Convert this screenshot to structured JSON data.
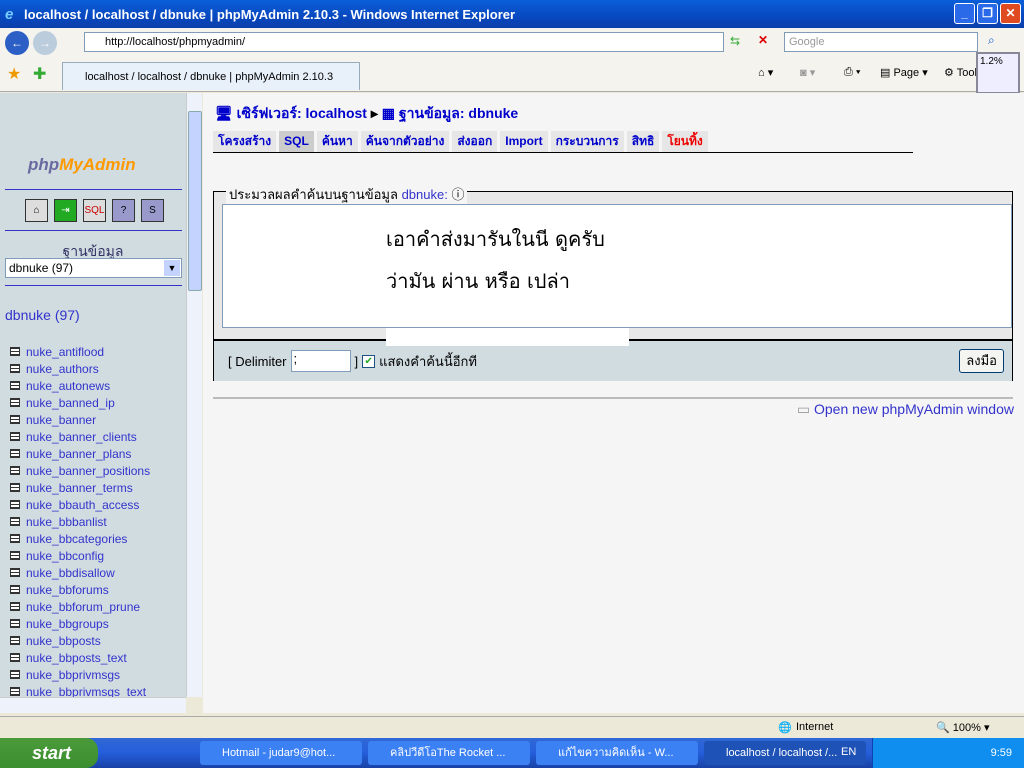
{
  "window": {
    "title": "localhost / localhost / dbnuke | phpMyAdmin 2.10.3 - Windows Internet Explorer"
  },
  "browser": {
    "url": "http://localhost/phpmyadmin/",
    "search_placeholder": "Google",
    "tab_title": "localhost / localhost / dbnuke | phpMyAdmin 2.10.3",
    "page_label": "Page",
    "tools_label": "Tools",
    "meter": "1.2%"
  },
  "sidebar": {
    "logo_php": "php",
    "logo_my": "MyAdmin",
    "db_label": "ฐานข้อมูล",
    "db_select": "dbnuke (97)",
    "db_name": "dbnuke (97)",
    "tables": [
      "nuke_antiflood",
      "nuke_authors",
      "nuke_autonews",
      "nuke_banned_ip",
      "nuke_banner",
      "nuke_banner_clients",
      "nuke_banner_plans",
      "nuke_banner_positions",
      "nuke_banner_terms",
      "nuke_bbauth_access",
      "nuke_bbbanlist",
      "nuke_bbcategories",
      "nuke_bbconfig",
      "nuke_bbdisallow",
      "nuke_bbforums",
      "nuke_bbforum_prune",
      "nuke_bbgroups",
      "nuke_bbposts",
      "nuke_bbposts_text",
      "nuke_bbprivmsgs",
      "nuke_bbprivmsgs_text"
    ]
  },
  "main": {
    "server_crumb": "เซิร์ฟเวอร์: localhost",
    "db_crumb": "ฐานข้อมูล: dbnuke",
    "tabs": [
      "โครงสร้าง",
      "SQL",
      "ค้นหา",
      "ค้นจากตัวอย่าง",
      "ส่งออก",
      "Import",
      "กระบวนการ",
      "สิทธิ",
      "โยนทิ้ง"
    ],
    "legend": "ประมวลผลคำค้นบนฐานข้อมูล",
    "legend_db": "dbnuke:",
    "sql_line1": "เอาคำส่งมารันในนี ดูครับ",
    "sql_line2": "ว่ามัน ผ่าน หรือ เปล่า",
    "delimiter_label": "[ Delimiter",
    "delimiter_value": ";",
    "bracket_close": "]",
    "show_again": "แสดงคำค้นนี้อีกที",
    "go": "ลงมือ",
    "new_window": "Open new phpMyAdmin window"
  },
  "status": {
    "zone": "Internet",
    "zoom": "100%"
  },
  "taskbar": {
    "start": "start",
    "items": [
      "Hotmail - judar9@hot...",
      "คลิปวีดีโอThe Rocket ...",
      "แก้ไขความคิดเห็น - W...",
      "localhost / localhost /..."
    ],
    "lang": "EN",
    "clock": "9:59"
  }
}
